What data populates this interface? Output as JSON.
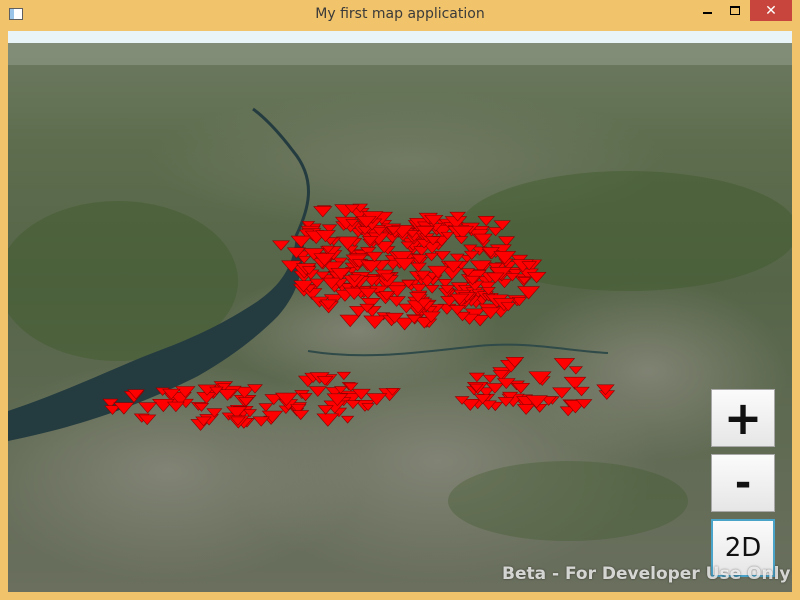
{
  "window": {
    "title": "My first map application"
  },
  "title_controls": {
    "minimize_icon": "minimize-icon",
    "maximize_icon": "maximize-icon",
    "close_glyph": "✕"
  },
  "map": {
    "zoom_in_label": "+",
    "zoom_out_label": "-",
    "mode_label": "2D",
    "watermark": "Beta - For Developer Use Only",
    "marker_color": "#ff0000",
    "water_color": "#243c40"
  },
  "colors": {
    "title_bar": "#f1c46b",
    "close_button": "#c7453c",
    "active_button_border": "#4aa3c8"
  }
}
